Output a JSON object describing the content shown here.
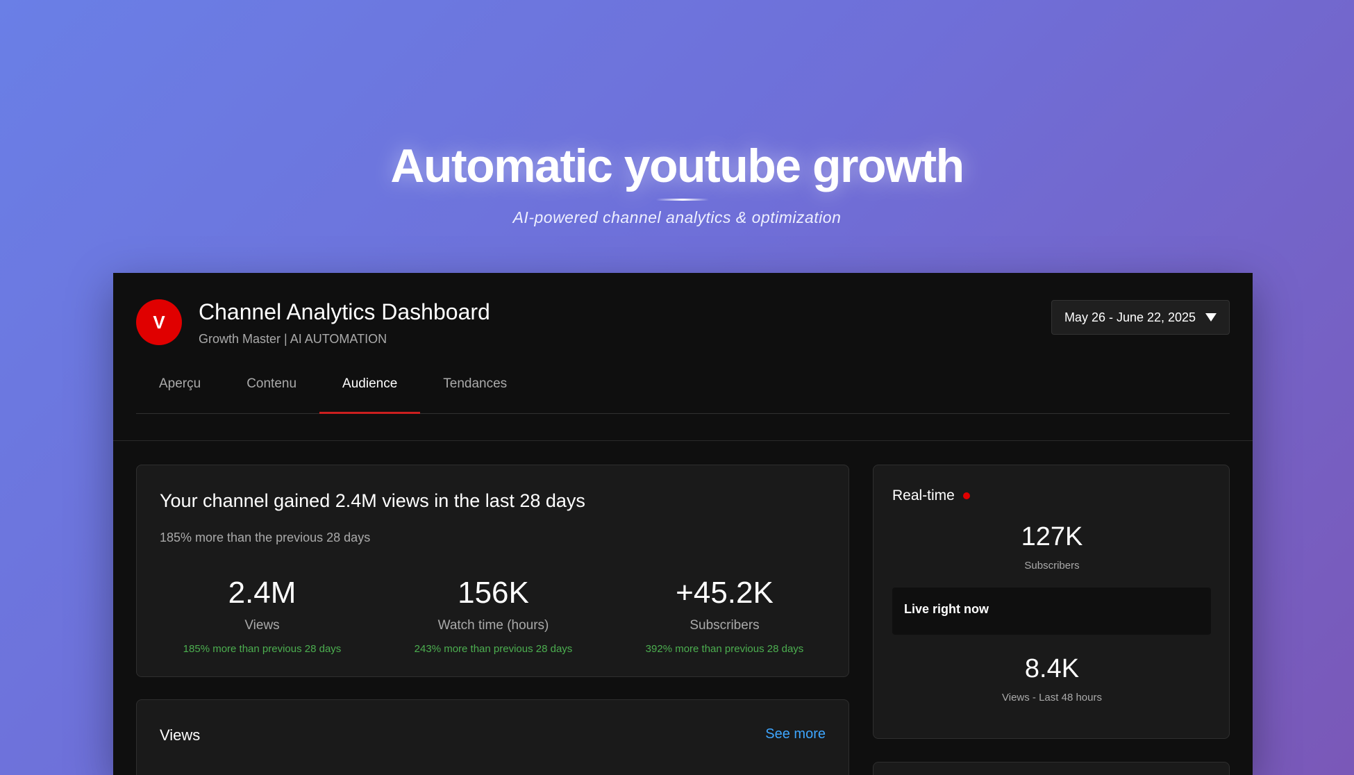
{
  "hero": {
    "title": "Automatic youtube growth",
    "subtitle": "AI-powered channel analytics & optimization"
  },
  "header": {
    "avatar_letter": "V",
    "title": "Channel Analytics Dashboard",
    "subtitle": "Growth Master | AI AUTOMATION",
    "date_range": "May 26 - June 22, 2025"
  },
  "tabs": [
    {
      "label": "Aperçu",
      "active": false
    },
    {
      "label": "Contenu",
      "active": false
    },
    {
      "label": "Audience",
      "active": true
    },
    {
      "label": "Tendances",
      "active": false
    }
  ],
  "summary": {
    "headline": "Your channel gained 2.4M views in the last 28 days",
    "subtext": "185% more than the previous 28 days",
    "metrics": [
      {
        "value": "2.4M",
        "label": "Views",
        "change": "185% more than previous 28 days"
      },
      {
        "value": "156K",
        "label": "Watch time (hours)",
        "change": "243% more than previous 28 days"
      },
      {
        "value": "+45.2K",
        "label": "Subscribers",
        "change": "392% more than previous 28 days"
      }
    ]
  },
  "views_card": {
    "title": "Views",
    "see_more": "See more"
  },
  "realtime": {
    "title": "Real-time",
    "subscribers_value": "127K",
    "subscribers_label": "Subscribers",
    "live_label": "Live right now",
    "views_value": "8.4K",
    "views_label": "Views - Last 48 hours"
  },
  "colors": {
    "accent_red": "#e00000",
    "positive_green": "#4caf50",
    "link_blue": "#3ea6ff",
    "panel_bg": "#0f0f0f",
    "card_bg": "#1a1a1a"
  }
}
